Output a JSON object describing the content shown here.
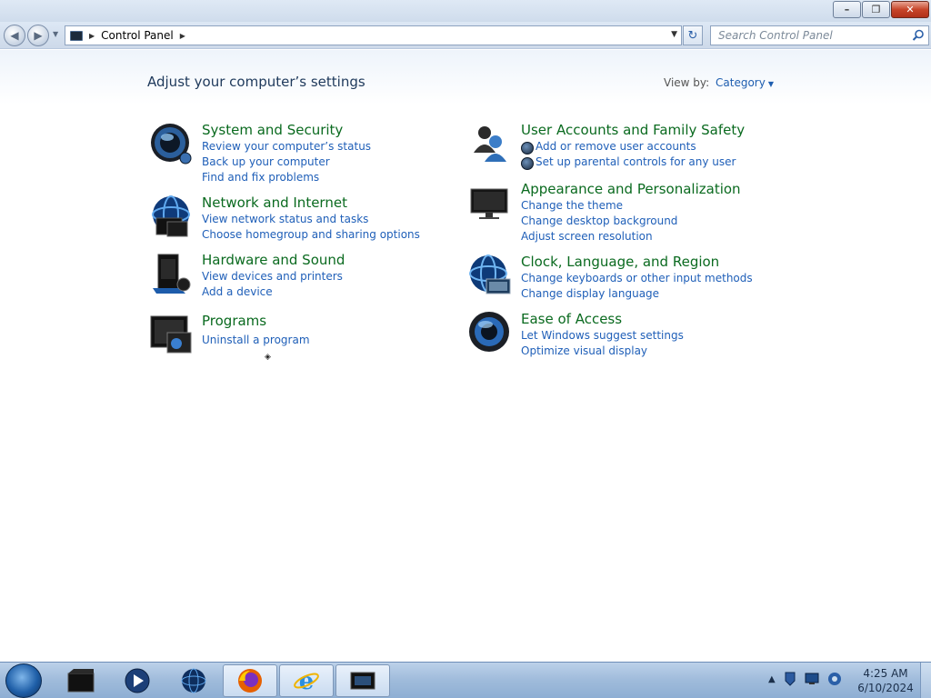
{
  "window": {
    "minimize_label": "–",
    "maximize_label": "❐",
    "close_label": "✕"
  },
  "navbar": {
    "breadcrumb": "Control Panel",
    "search_placeholder": "Search Control Panel",
    "back_icon": "back-arrow-icon",
    "forward_icon": "forward-arrow-icon",
    "refresh_icon": "refresh-icon",
    "search_icon": "magnifier-icon"
  },
  "content": {
    "title": "Adjust your computer’s settings",
    "view_by_label": "View by:",
    "view_by_value": "Category",
    "categories": [
      {
        "title": "System and Security",
        "icon": "system-security-icon",
        "links": [
          "Review your computer’s status",
          "Back up your computer",
          "Find and fix problems"
        ]
      },
      {
        "title": "Network and Internet",
        "icon": "network-internet-icon",
        "links": [
          "View network status and tasks",
          "Choose homegroup and sharing options"
        ]
      },
      {
        "title": "Hardware and Sound",
        "icon": "hardware-sound-icon",
        "links": [
          "View devices and printers",
          "Add a device"
        ]
      },
      {
        "title": "Programs",
        "icon": "programs-icon",
        "links": [
          "Uninstall a program"
        ]
      },
      {
        "title": "User Accounts and Family Safety",
        "icon": "user-accounts-icon",
        "links": [
          "Add or remove user accounts",
          "Set up parental controls for any user"
        ]
      },
      {
        "title": "Appearance and Personalization",
        "icon": "appearance-icon",
        "links": [
          "Change the theme",
          "Change desktop background",
          "Adjust screen resolution"
        ]
      },
      {
        "title": "Clock, Language, and Region",
        "icon": "clock-language-icon",
        "links": [
          "Change keyboards or other input methods",
          "Change display language"
        ]
      },
      {
        "title": "Ease of Access",
        "icon": "ease-of-access-icon",
        "links": [
          "Let Windows suggest settings",
          "Optimize visual display"
        ]
      }
    ]
  },
  "taskbar": {
    "items": [
      "start-orb",
      "explorer-icon",
      "media-player-icon",
      "network-globe-icon",
      "firefox-icon",
      "internet-explorer-icon",
      "control-panel-icon"
    ],
    "tray_icons": [
      "show-hidden-icons",
      "action-center-flag-icon",
      "network-icon",
      "volume-icon"
    ],
    "time": "4:25 AM",
    "date": "6/10/2024"
  },
  "colors": {
    "category_title": "#0a6a1f",
    "link": "#1f5fb8",
    "heading": "#1e395b",
    "taskbar": "#9fbbdb"
  }
}
